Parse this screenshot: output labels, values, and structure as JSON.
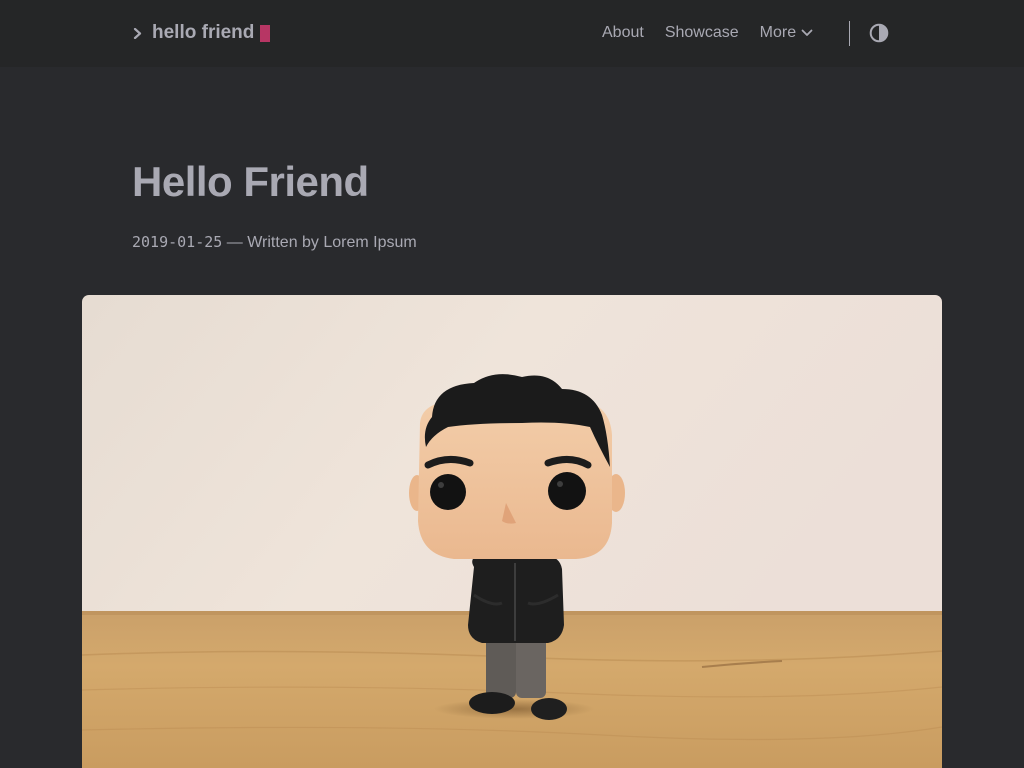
{
  "header": {
    "logo": {
      "icon": "chevron-right-icon",
      "text": "hello friend",
      "cursor_color": "#c8386b"
    },
    "nav": {
      "items": [
        {
          "label": "About"
        },
        {
          "label": "Showcase"
        },
        {
          "label": "More",
          "icon": "chevron-down-icon"
        }
      ]
    },
    "theme_toggle": {
      "icon": "contrast-icon"
    }
  },
  "post": {
    "title": "Hello Friend",
    "date": "2019-01-25",
    "byline": " — Written by Lorem Ipsum",
    "cover": {
      "subject": "vinyl-figure-photo"
    }
  },
  "colors": {
    "background": "#292a2d",
    "header_background": "#252627",
    "text": "#a9a9b3",
    "accent": "#c8386b"
  }
}
